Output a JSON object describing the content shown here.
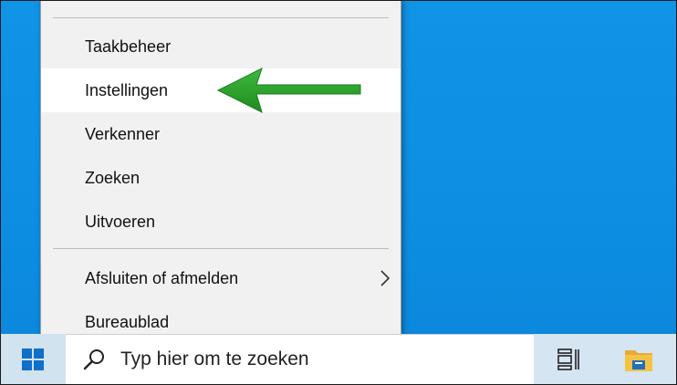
{
  "context_menu": {
    "items": [
      {
        "label": "Taakbeheer"
      },
      {
        "label": "Instellingen",
        "highlighted": true
      },
      {
        "label": "Verkenner"
      },
      {
        "label": "Zoeken"
      },
      {
        "label": "Uitvoeren"
      },
      {
        "label": "Afsluiten of afmelden",
        "has_submenu": true
      },
      {
        "label": "Bureaublad"
      }
    ]
  },
  "taskbar": {
    "search": {
      "placeholder": "Typ hier om te zoeken"
    },
    "icons": {
      "start": "windows-logo-icon",
      "search": "search-icon",
      "task_view": "task-view-icon",
      "file_explorer": "folder-icon"
    }
  },
  "annotation": {
    "arrow_color": "#2ea12e",
    "points_to": "Instellingen"
  },
  "colors": {
    "desktop": "#0d8ee3",
    "taskbar": "#d5e5f2",
    "menu_bg": "#f1f1f1",
    "highlight": "#ffffff"
  }
}
